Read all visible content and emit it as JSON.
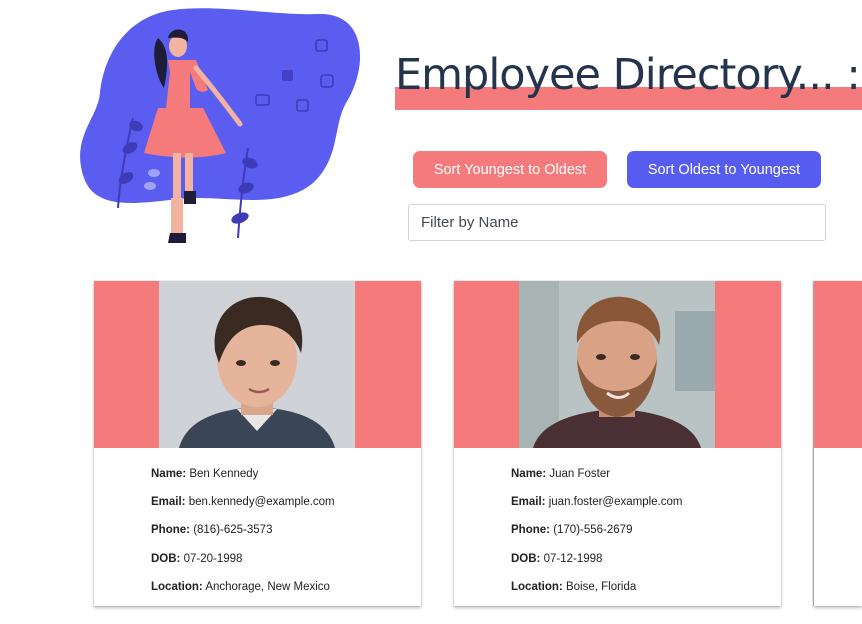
{
  "header": {
    "title": "Employee Directory... :",
    "illustration_icon": "woman-with-social-media-icons-illustration"
  },
  "controls": {
    "sort_young_label": "Sort Youngest to Oldest",
    "sort_old_label": "Sort Oldest to Youngest",
    "filter_placeholder": "Filter by Name"
  },
  "labels": {
    "name": "Name:",
    "email": "Email:",
    "phone": "Phone:",
    "dob": "DOB:",
    "location": "Location:"
  },
  "employees": [
    {
      "name": "Ben Kennedy",
      "email": "ben.kennedy@example.com",
      "phone": "(816)-625-3573",
      "dob": "07-20-1998",
      "location": "Anchorage, New Mexico"
    },
    {
      "name": "Juan Foster",
      "email": "juan.foster@example.com",
      "phone": "(170)-556-2679",
      "dob": "07-12-1998",
      "location": "Boise, Florida"
    },
    {}
  ],
  "colors": {
    "accent_coral": "#f57a7c",
    "accent_indigo": "#575cf1",
    "title_text": "#24344d"
  }
}
